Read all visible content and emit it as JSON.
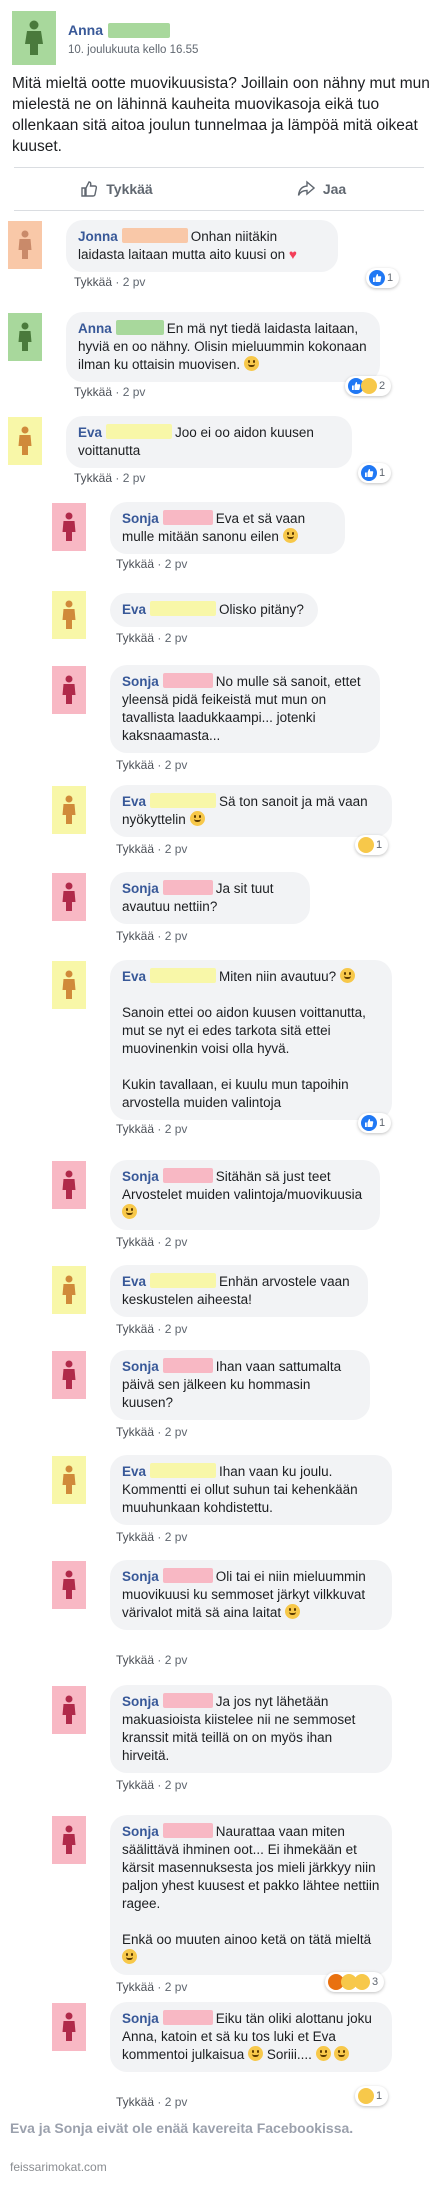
{
  "post": {
    "author": "Anna",
    "timestamp": "10. joulukuuta kello 16.55",
    "text": "Mitä mieltä ootte muovikuusista? Joillain oon nähny mut mun mielestä ne on lähinnä kauheita muovikasoja eikä tuo ollenkaan sitä aitoa joulun tunnelmaa ja lämpöä mitä oikeat kuuset.",
    "like_label": "Tykkää",
    "share_label": "Jaa"
  },
  "colors": {
    "anna": "#a8d89c",
    "jonna": "#f9c8a8",
    "eva": "#f8f7a8",
    "sonja": "#f8b8c4",
    "link": "#385898",
    "like_blue": "#2078f4"
  },
  "reply_label": "Tykkää",
  "time_label": "2 pv",
  "comments": [
    {
      "name": "Jonna",
      "text": "Onhan niitäkin laidasta laitaan mutta aito kuusi on",
      "suffix": "♥",
      "reaction_count": "1"
    },
    {
      "name": "Anna",
      "text": "En mä nyt tiedä laidasta laitaan, hyviä en oo nähny. Olisin mieluummin kokonaan ilman ku ottaisin muovisen.",
      "reaction_count": "2"
    },
    {
      "name": "Eva",
      "text": "Joo ei oo aidon kuusen voittanutta",
      "reaction_count": "1"
    },
    {
      "name": "Sonja",
      "text": "Eva et sä vaan mulle mitään sanonu eilen"
    },
    {
      "name": "Eva",
      "text": "Olisko pitäny?"
    },
    {
      "name": "Sonja",
      "text": "No mulle sä sanoit, ettet yleensä pidä feikeistä mut mun on tavallista laadukkaampi... jotenki kaksnaamasta..."
    },
    {
      "name": "Eva",
      "text": "Sä ton sanoit ja mä vaan nyökyttelin",
      "reaction_count": "1"
    },
    {
      "name": "Sonja",
      "text": "Ja sit tuut avautuu nettiin?"
    },
    {
      "name": "Eva",
      "text": "Miten niin avautuu?",
      "p2": "Sanoin ettei oo aidon kuusen voittanutta, mut se nyt ei edes tarkota sitä ettei muovinenkin voisi olla hyvä.",
      "p3": "Kukin tavallaan, ei kuulu mun tapoihin arvostella muiden valintoja",
      "reaction_count": "1"
    },
    {
      "name": "Sonja",
      "text": "Sitähän sä just teet Arvostelet muiden valintoja/muovikuusia"
    },
    {
      "name": "Eva",
      "text": "Enhän arvostele vaan keskustelen aiheesta!"
    },
    {
      "name": "Sonja",
      "text": "Ihan vaan sattumalta päivä sen jälkeen ku hommasin kuusen?"
    },
    {
      "name": "Eva",
      "text": "Ihan vaan ku joulu. Kommentti ei ollut suhun tai kehenkään muuhunkaan kohdistettu."
    },
    {
      "name": "Sonja",
      "text": "Oli tai ei niin mieluummin muovikuusi ku semmoset järkyt vilkkuvat värivalot mitä sä aina laitat"
    },
    {
      "name": "Sonja",
      "text": "Ja jos nyt lähetään makuasioista kiistelee nii ne semmoset kranssit mitä teillä on on myös ihan hirveitä."
    },
    {
      "name": "Sonja",
      "text": "Naurattaa vaan miten säälittävä ihminen oot... Ei ihmekään et kärsit masennuksesta jos mieli järkkyy niin paljon yhest kuusest et pakko lähtee nettiin ragee.",
      "p2": "Enkä oo muuten ainoo ketä on tätä mieltä",
      "reaction_count": "3"
    },
    {
      "name": "Sonja",
      "text": "Eiku tän oliki alottanu joku Anna, katoin et sä ku tos luki et Eva kommentoi julkaisua",
      "suffix": "Soriii....",
      "reaction_count": "1"
    }
  ],
  "caption": "Eva ja Sonja eivät ole enää kavereita Facebookissa.",
  "watermark": "feissarimokat.com"
}
